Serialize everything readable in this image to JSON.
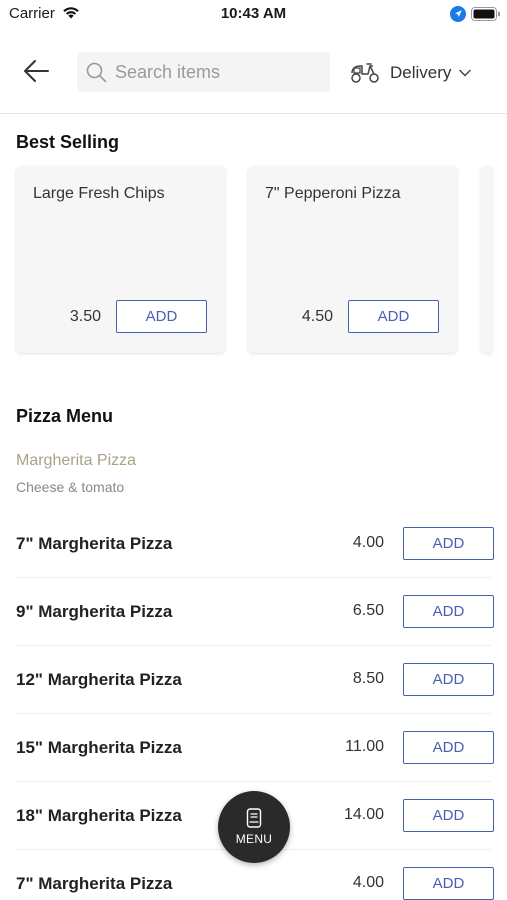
{
  "status_bar": {
    "carrier": "Carrier",
    "time": "10:43 AM"
  },
  "header": {
    "search_placeholder": "Search items",
    "delivery_label": "Delivery"
  },
  "best_selling": {
    "title": "Best Selling",
    "items": [
      {
        "name": "Large Fresh Chips",
        "price": "3.50",
        "add_label": "ADD"
      },
      {
        "name": "7\" Pepperoni Pizza",
        "price": "4.50",
        "add_label": "ADD"
      }
    ]
  },
  "pizza_menu": {
    "title": "Pizza Menu",
    "subcategory": {
      "name": "Margherita Pizza",
      "description": "Cheese & tomato"
    },
    "items": [
      {
        "name": "7\" Margherita Pizza",
        "price": "4.00",
        "add_label": "ADD"
      },
      {
        "name": "9\" Margherita Pizza",
        "price": "6.50",
        "add_label": "ADD"
      },
      {
        "name": "12\" Margherita Pizza",
        "price": "8.50",
        "add_label": "ADD"
      },
      {
        "name": "15\" Margherita Pizza",
        "price": "11.00",
        "add_label": "ADD"
      },
      {
        "name": "18\" Margherita Pizza",
        "price": "14.00",
        "add_label": "ADD"
      },
      {
        "name": "7\" Margherita Pizza",
        "price": "4.00",
        "add_label": "ADD"
      }
    ]
  },
  "fab": {
    "label": "MENU",
    "icon": "menu-card-icon"
  },
  "colors": {
    "accent": "#4a5fb0",
    "subcategory": "#a9a285",
    "fab": "#2a2a2a"
  }
}
